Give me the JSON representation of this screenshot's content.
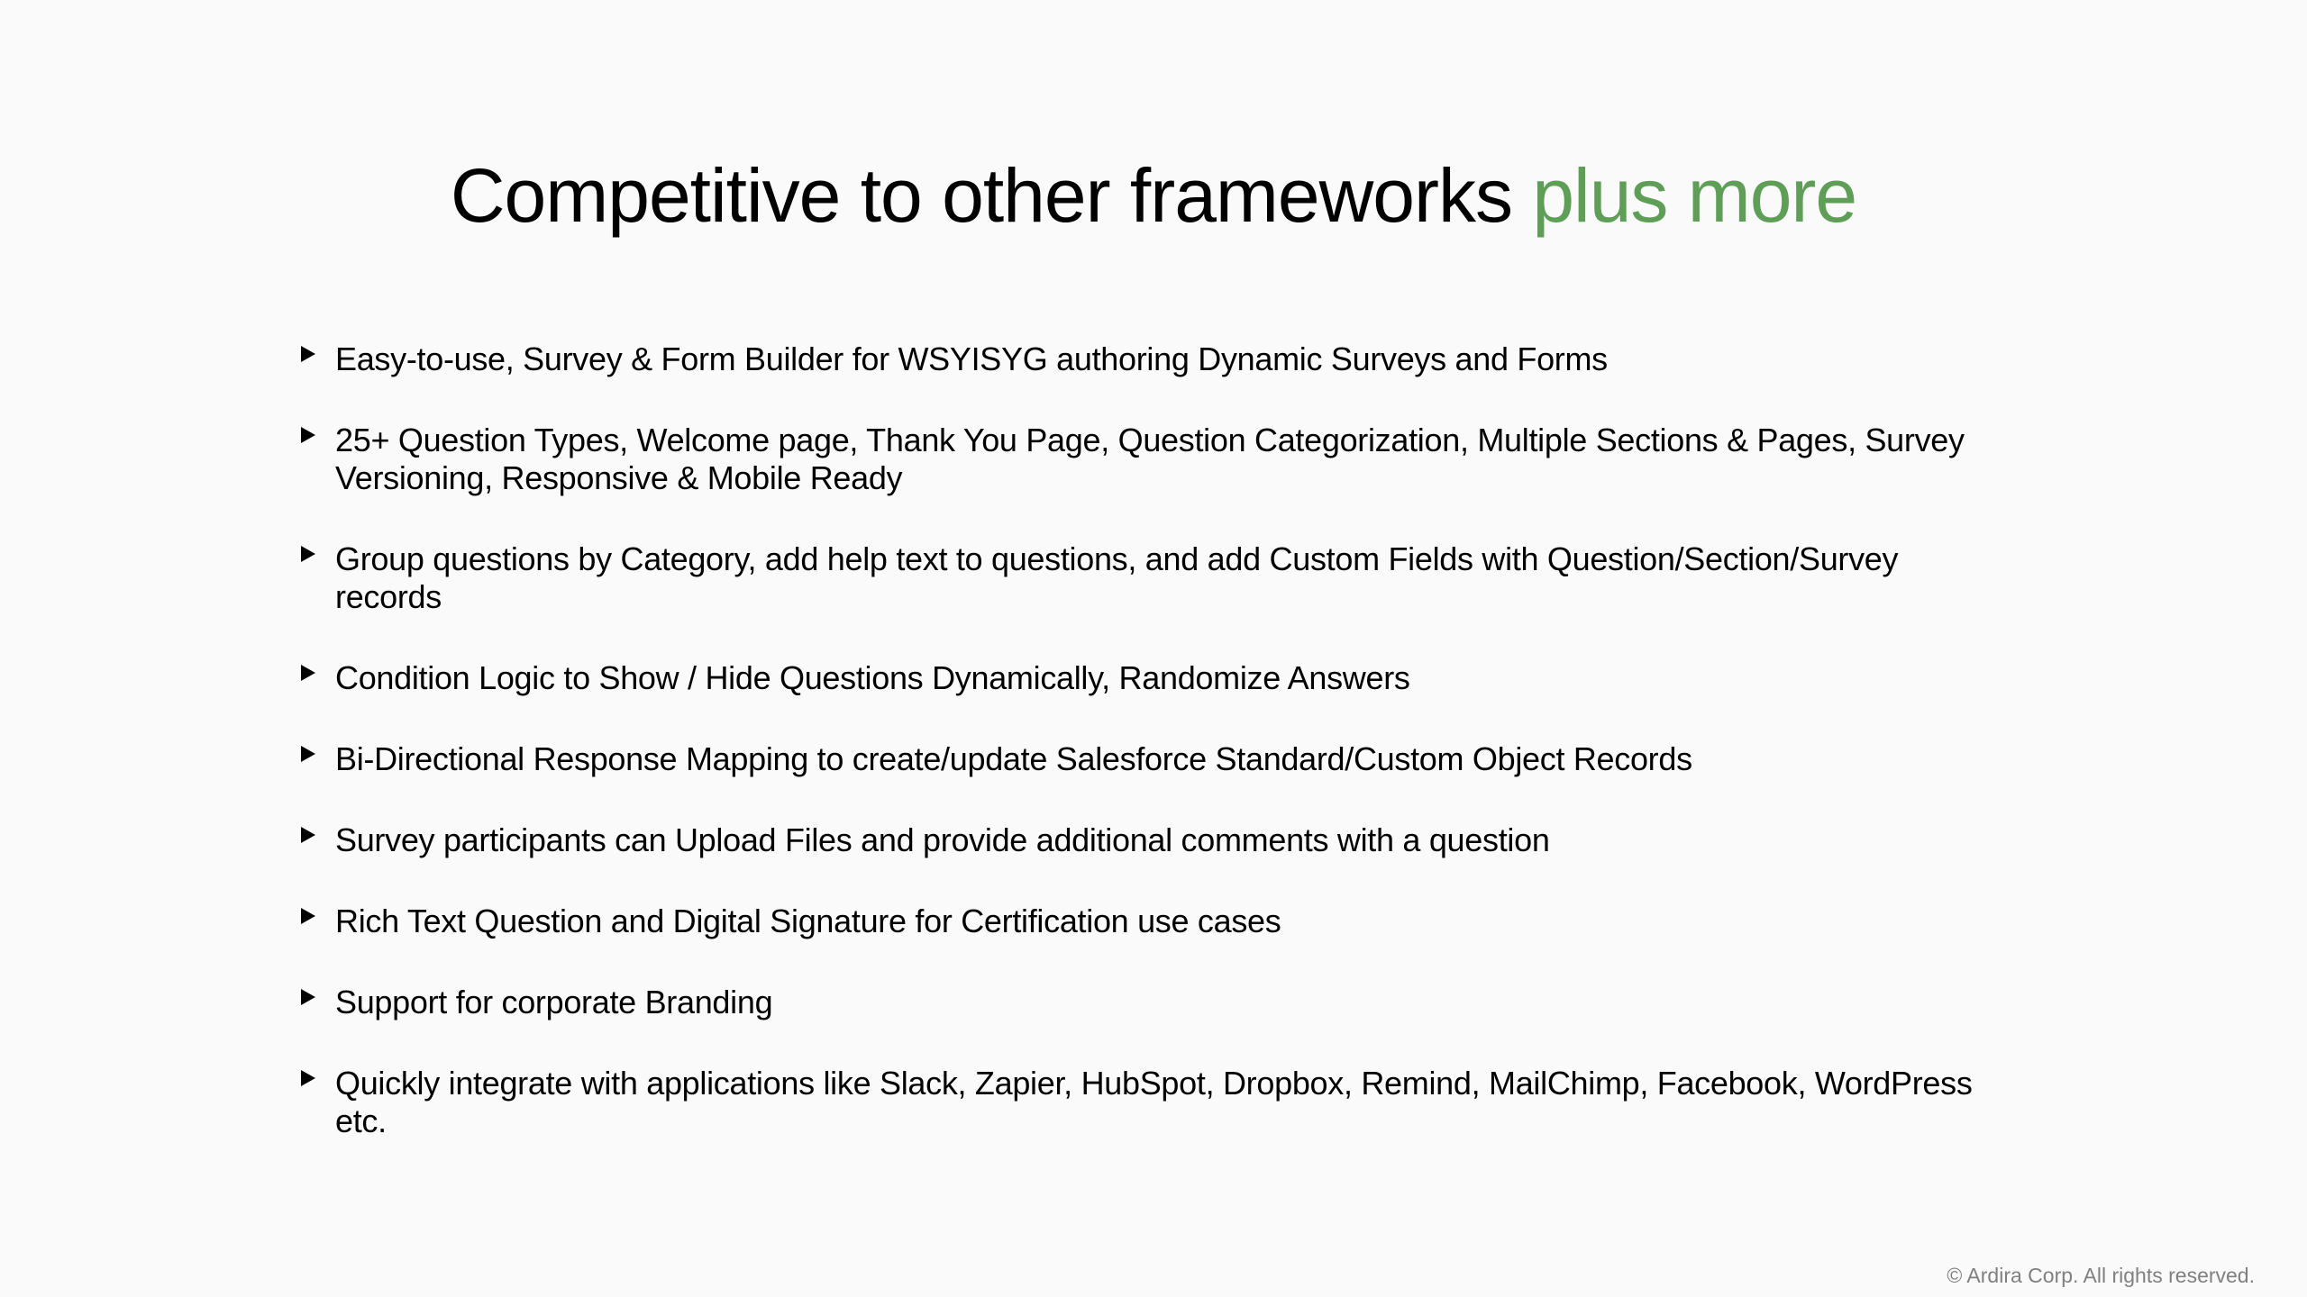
{
  "slide": {
    "title": {
      "main": "Competitive to other frameworks ",
      "accent": "plus more",
      "accent_color": "#5e9e57"
    },
    "bullets": [
      {
        "icon": "triangle-bullet-icon",
        "text": "Easy-to-use, Survey & Form Builder for WSYISYG authoring Dynamic Surveys and Forms"
      },
      {
        "icon": "triangle-bullet-icon",
        "text": "25+ Question Types, Welcome page, Thank You Page, Question Categorization, Multiple Sections & Pages, Survey Versioning, Responsive & Mobile Ready"
      },
      {
        "icon": "triangle-bullet-icon",
        "text": "Group questions by Category, add help text to questions, and add Custom Fields with Question/Section/Survey records"
      },
      {
        "icon": "triangle-bullet-icon",
        "text": "Condition Logic to Show / Hide Questions Dynamically, Randomize Answers"
      },
      {
        "icon": "triangle-bullet-icon",
        "text": "Bi-Directional Response Mapping to create/update Salesforce Standard/Custom Object Records"
      },
      {
        "icon": "triangle-bullet-icon",
        "text": "Survey participants can Upload Files and provide additional comments with a question"
      },
      {
        "icon": "triangle-bullet-icon",
        "text": "Rich Text Question and Digital Signature for Certification use cases"
      },
      {
        "icon": "triangle-bullet-icon",
        "text": "Support for corporate Branding"
      },
      {
        "icon": "triangle-bullet-icon",
        "text": "Quickly integrate with applications like Slack, Zapier, HubSpot, Dropbox, Remind, MailChimp, Facebook, WordPress etc."
      }
    ],
    "footer": "© Ardira Corp. All rights reserved."
  }
}
